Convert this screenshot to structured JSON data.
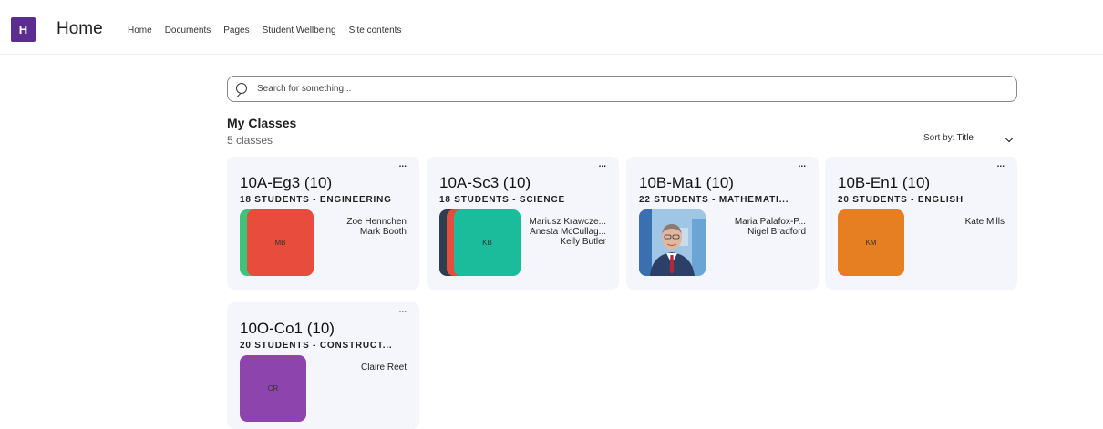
{
  "site": {
    "logo_letter": "H",
    "title": "Home"
  },
  "nav": {
    "items": [
      "Home",
      "Documents",
      "Pages",
      "Student Wellbeing",
      "Site contents"
    ]
  },
  "search": {
    "placeholder": "Search for something..."
  },
  "section": {
    "title": "My Classes",
    "count": "5 classes"
  },
  "sort": {
    "label": "Sort by:",
    "value": "Title"
  },
  "colors": {
    "logo": "#5c2d91",
    "card_bg": "#f5f6fb"
  },
  "classes": [
    {
      "name": "10A-Eg3 (10)",
      "subtitle": "18 STUDENTS - ENGINEERING",
      "more": "...",
      "tiles": [
        {
          "initials": "",
          "color": "#3fc27a"
        },
        {
          "initials": "MB",
          "color": "#e74c3c"
        }
      ],
      "teachers": [
        "Zoe Hennchen",
        "Mark Booth"
      ]
    },
    {
      "name": "10A-Sc3 (10)",
      "subtitle": "18 STUDENTS - SCIENCE",
      "more": "...",
      "tiles": [
        {
          "initials": "",
          "color": "#2c3e50"
        },
        {
          "initials": "",
          "color": "#e74c3c"
        },
        {
          "initials": "KB",
          "color": "#1abc9c"
        }
      ],
      "teachers": [
        "Mariusz Krawcze...",
        "Anesta McCullag...",
        "Kelly Butler"
      ]
    },
    {
      "name": "10B-Ma1 (10)",
      "subtitle": "22 STUDENTS - MATHEMATI...",
      "more": "...",
      "tiles": [
        {
          "initials": "",
          "color": "photo"
        }
      ],
      "teachers": [
        "Maria Palafox-P...",
        "Nigel Bradford"
      ]
    },
    {
      "name": "10B-En1 (10)",
      "subtitle": "20 STUDENTS - ENGLISH",
      "more": "...",
      "tiles": [
        {
          "initials": "KM",
          "color": "#e67e22"
        }
      ],
      "teachers": [
        "Kate Mills"
      ]
    },
    {
      "name": "10O-Co1 (10)",
      "subtitle": "20 STUDENTS - CONSTRUCT...",
      "more": "...",
      "tiles": [
        {
          "initials": "CR",
          "color": "#8e44ad"
        }
      ],
      "teachers": [
        "Claire Reet"
      ]
    }
  ]
}
